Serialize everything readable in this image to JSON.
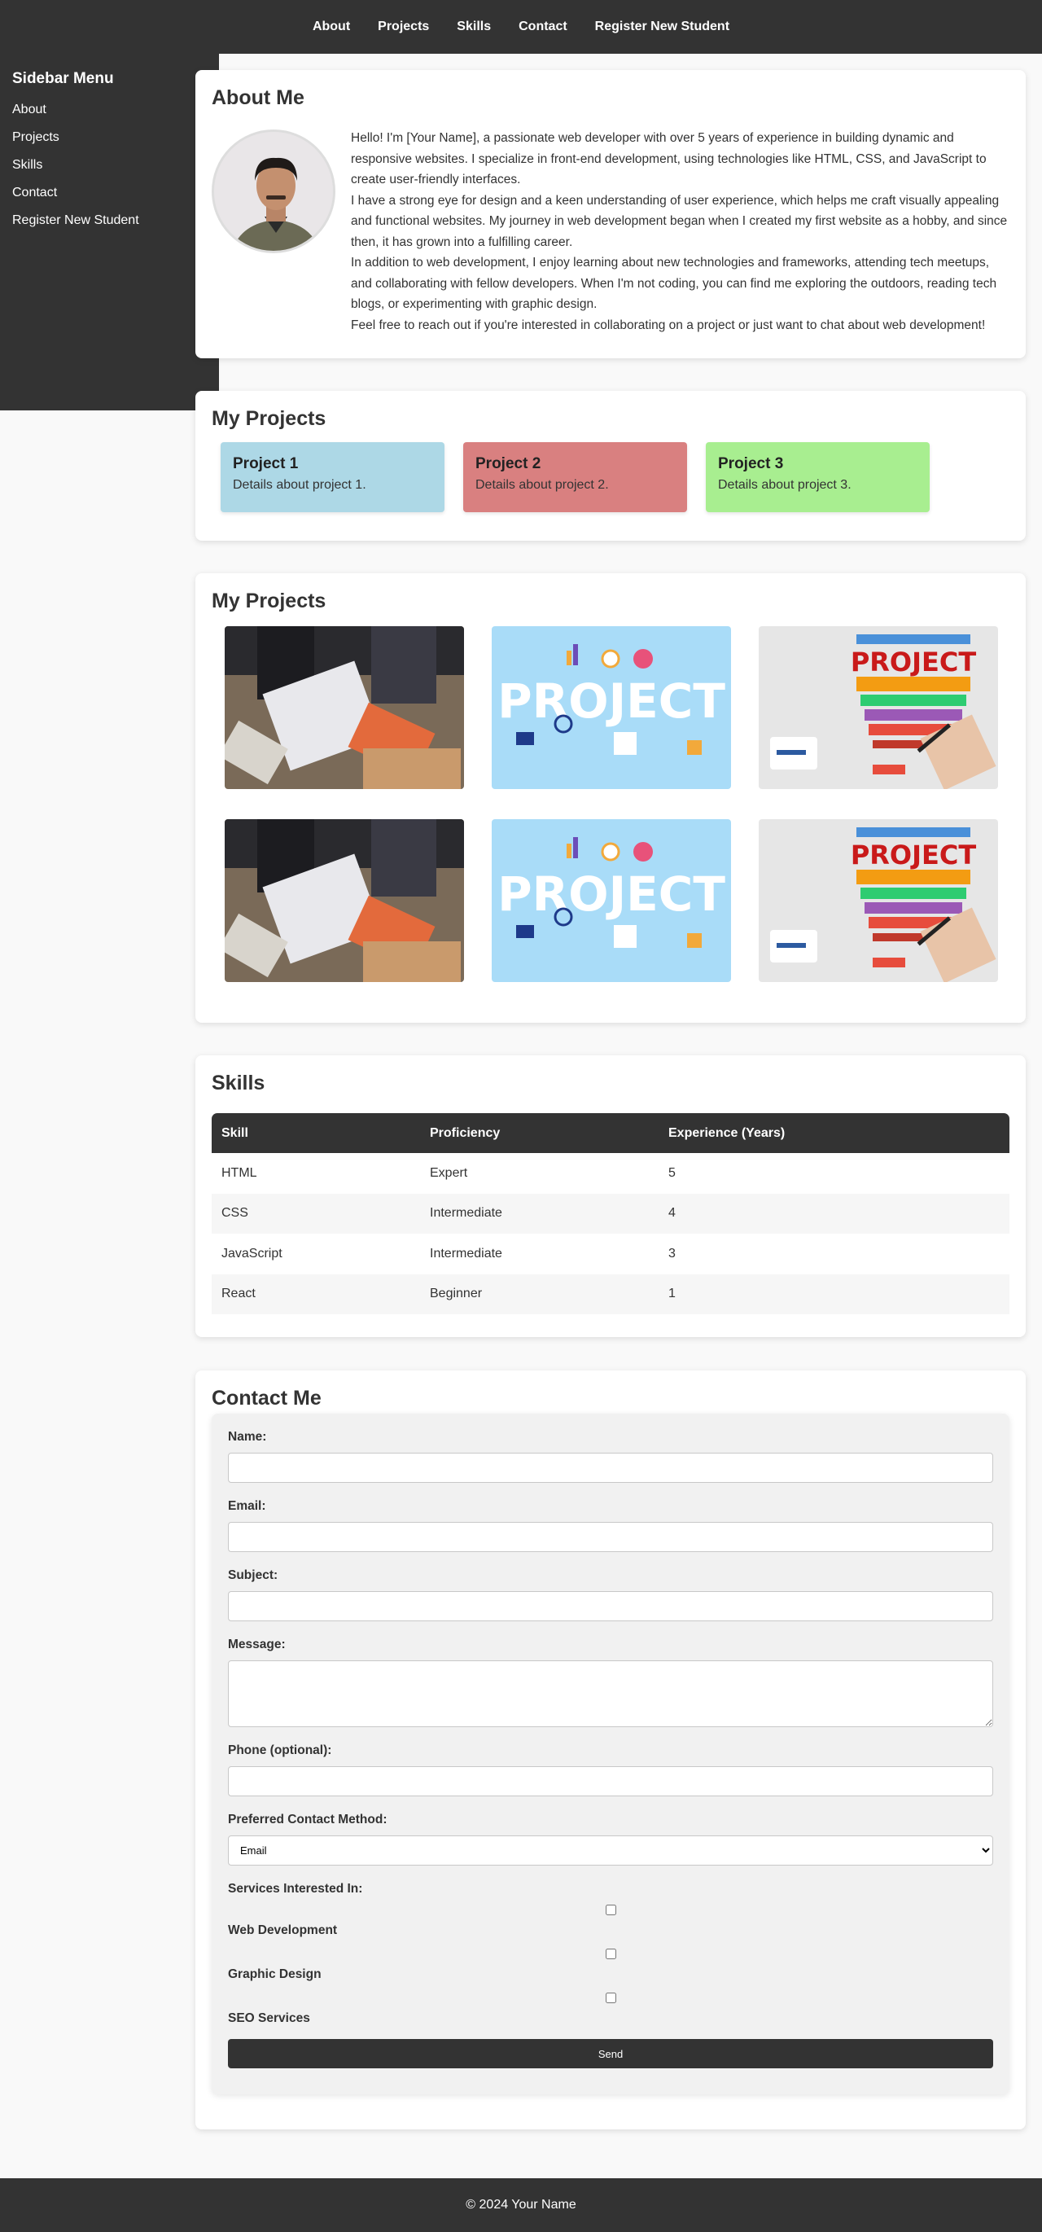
{
  "nav": {
    "items": [
      "About",
      "Projects",
      "Skills",
      "Contact",
      "Register New Student"
    ]
  },
  "sidebar": {
    "title": "Sidebar Menu",
    "items": [
      "About",
      "Projects",
      "Skills",
      "Contact",
      "Register New Student"
    ]
  },
  "about": {
    "heading": "About Me",
    "paragraphs": [
      "Hello! I'm [Your Name], a passionate web developer with over 5 years of experience in building dynamic and responsive websites. I specialize in front-end development, using technologies like HTML, CSS, and JavaScript to create user-friendly interfaces.",
      "I have a strong eye for design and a keen understanding of user experience, which helps me craft visually appealing and functional websites. My journey in web development began when I created my first website as a hobby, and since then, it has grown into a fulfilling career.",
      "In addition to web development, I enjoy learning about new technologies and frameworks, attending tech meetups, and collaborating with fellow developers. When I'm not coding, you can find me exploring the outdoors, reading tech blogs, or experimenting with graphic design.",
      "Feel free to reach out if you're interested in collaborating on a project or just want to chat about web development!"
    ]
  },
  "project_cards": {
    "heading": "My Projects",
    "items": [
      {
        "title": "Project 1",
        "details": "Details about project 1.",
        "color": "#add8e6"
      },
      {
        "title": "Project 2",
        "details": "Details about project 2.",
        "color": "#d98080"
      },
      {
        "title": "Project 3",
        "details": "Details about project 3.",
        "color": "#a8ee90"
      }
    ]
  },
  "gallery": {
    "heading": "My Projects",
    "word": "PROJECT",
    "tiles": [
      "team-photo",
      "project-illustration",
      "project-lightbulb",
      "team-photo",
      "project-illustration",
      "project-lightbulb"
    ]
  },
  "skills": {
    "heading": "Skills",
    "columns": [
      "Skill",
      "Proficiency",
      "Experience (Years)"
    ],
    "rows": [
      [
        "HTML",
        "Expert",
        "5"
      ],
      [
        "CSS",
        "Intermediate",
        "4"
      ],
      [
        "JavaScript",
        "Intermediate",
        "3"
      ],
      [
        "React",
        "Beginner",
        "1"
      ]
    ]
  },
  "contact": {
    "heading": "Contact Me",
    "name_label": "Name:",
    "email_label": "Email:",
    "subject_label": "Subject:",
    "message_label": "Message:",
    "phone_label": "Phone (optional):",
    "method_label": "Preferred Contact Method:",
    "method_selected": "Email",
    "services_label": "Services Interested In:",
    "services": [
      "Web Development",
      "Graphic Design",
      "SEO Services"
    ],
    "send_label": "Send"
  },
  "footer": {
    "text": "© 2024 Your Name"
  },
  "colors": {
    "dark": "#333333",
    "page_bg": "#f9f9f9"
  }
}
